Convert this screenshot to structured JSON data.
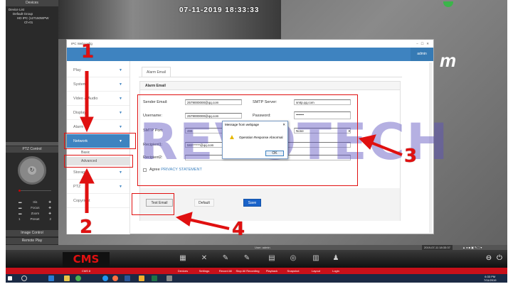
{
  "left_panel": {
    "devices_header": "Devices",
    "tree": [
      "Device List",
      "Default Group",
      "HD IPC (127150WPW",
      "Ch-01"
    ],
    "ptz_header": "PTZ Control",
    "ptz_rows": [
      {
        "label": "Iris"
      },
      {
        "label": "Focus"
      },
      {
        "label": "Zoom"
      },
      {
        "label": "Preset",
        "left": "1",
        "right": "2"
      }
    ],
    "image_control": "Image Control",
    "remote_play": "Remote Play"
  },
  "camera": {
    "timestamp": "07-11-2019 18:33:33"
  },
  "window": {
    "title": "IPC Webconfig",
    "user": "admin",
    "sidebar": [
      {
        "label": "Play"
      },
      {
        "label": "System"
      },
      {
        "label": "Video & Audio"
      },
      {
        "label": "Display"
      },
      {
        "label": "Alarm"
      },
      {
        "label": "Network",
        "active": true
      },
      {
        "label": "Storage"
      },
      {
        "label": "PTZ"
      },
      {
        "label": "Copyright"
      }
    ],
    "network_sub": [
      "Basic",
      "Advanced"
    ],
    "tab": "Alarm Email",
    "panel_title": "Alarm Email",
    "form": {
      "sender_email_label": "Sender Email:",
      "sender_email": "2579000000@qq.com",
      "smtp_server_label": "SMTP Server:",
      "smtp_server": "smtp.qq.com",
      "username_label": "Username:",
      "username": "2579000000@qq.com",
      "password_label": "Password:",
      "password": "•••••••",
      "smtp_port_label": "SMTP Port:",
      "smtp_port": "465",
      "encryption": "None",
      "recipient1_label": "Recipient1:",
      "recipient1": "583******@qq.com",
      "recipient2_label": "Recipient2:",
      "recipient2": "",
      "agree": "Agree",
      "privacy": "PRIVACY STATEMENT"
    },
    "buttons": {
      "test_email": "Test Email",
      "default": "Default",
      "save": "Save"
    },
    "dialog": {
      "title": "Message from webpage",
      "message": "Operation Response Abnormal",
      "ok": "OK"
    }
  },
  "watermark": "REVOTECH",
  "annotations": [
    "1",
    "2",
    "3",
    "4"
  ],
  "cms": {
    "user": "User: admin",
    "datetime": "2019-07-11 18:33:37",
    "logo": "CMS",
    "version": "CMS 8",
    "tools": [
      "Devices",
      "Settings",
      "Record All",
      "Stop All Recording",
      "Playback",
      "Snapshot",
      "Layout",
      "Login"
    ]
  },
  "taskbar": {
    "time": "6:33 PM",
    "date": "7/11/2019"
  },
  "colors": {
    "accent": "#3e83c0",
    "annotation": "#e01010",
    "cms_red": "#c8101a"
  }
}
